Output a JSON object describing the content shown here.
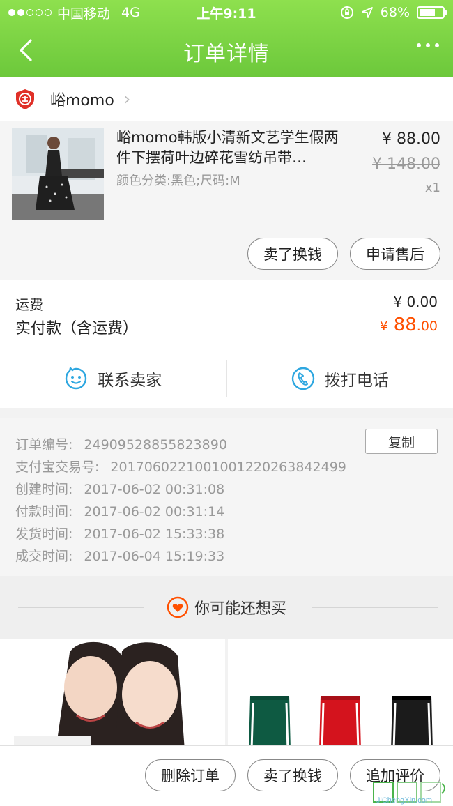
{
  "status_bar": {
    "carrier": "中国移动",
    "network": "4G",
    "time": "上午9:11",
    "battery": "68%",
    "battery_level": 0.68
  },
  "navbar": {
    "title": "订单详情"
  },
  "shop": {
    "name": "峪momo"
  },
  "product": {
    "title": "峪momo韩版小清新文艺学生假两件下摆荷叶边碎花雪纺吊带…",
    "attributes": "颜色分类:黑色;尺码:M",
    "price": "¥ 88.00",
    "original_price": "¥ 148.00",
    "quantity": "x1",
    "actions": {
      "sell": "卖了换钱",
      "after_sale": "申请售后"
    }
  },
  "totals": {
    "shipping_label": "运费",
    "shipping_value": "¥ 0.00",
    "paid_label": "实付款（含运费）",
    "paid_symbol": "¥",
    "paid_int": "88",
    "paid_dec": ".00"
  },
  "contact": {
    "seller": "联系卖家",
    "phone": "拨打电话"
  },
  "order_info": {
    "copy": "复制",
    "rows": [
      {
        "label": "订单编号:",
        "value": "24909528855823890"
      },
      {
        "label": "支付宝交易号:",
        "value": "2017060221001001220263842499"
      },
      {
        "label": "创建时间:",
        "value": "2017-06-02 00:31:08"
      },
      {
        "label": "付款时间:",
        "value": "2017-06-02 00:31:14"
      },
      {
        "label": "发货时间:",
        "value": "2017-06-02 15:33:38"
      },
      {
        "label": "成交时间:",
        "value": "2017-06-04 15:19:33"
      }
    ]
  },
  "recommend": {
    "title": "你可能还想买"
  },
  "bottom_actions": {
    "delete": "删除订单",
    "sell": "卖了换钱",
    "review": "追加评价"
  },
  "watermark": {
    "text": "JiChengXin.com"
  },
  "colors": {
    "header_green": "#6cc83b",
    "price_orange": "#ff5000",
    "icon_blue": "#2ea7e0"
  }
}
